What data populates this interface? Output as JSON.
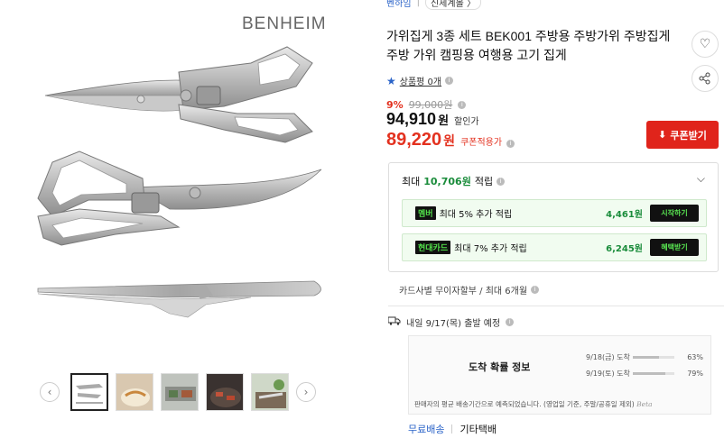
{
  "gallery": {
    "brand": "BENHEIM",
    "prev_icon": "chevron-left-icon",
    "next_icon": "chevron-right-icon",
    "thumbnail_count": 5,
    "active_thumbnail": 1
  },
  "breadcrumb": {
    "item1": "벤하임",
    "separator": "|",
    "item2": "신세계몰 〉"
  },
  "product": {
    "title": "가위집게 3종 세트 BEK001 주방용 주방가위 주방집게 주방 가위 캠핑용 여행용 고기 집게",
    "rating_label": "상품평 0개",
    "discount_rate": "9%",
    "original_price": "99,000원",
    "sale_price": "94,910",
    "sale_price_unit": "원",
    "sale_price_label": "할인가",
    "coupon_price": "89,220",
    "coupon_price_unit": "원",
    "coupon_price_label": "쿠폰적용가",
    "coupon_button": "쿠폰받기",
    "like_icon": "heart-icon",
    "share_icon": "share-icon"
  },
  "rewards": {
    "header_prefix": "최대",
    "header_amount": "10,706원",
    "header_suffix": "적립",
    "rows": [
      {
        "tag": "멤버",
        "text": "최대 5% 추가 적립",
        "amount": "4,461원",
        "button": "시작하기"
      },
      {
        "tag": "현대카드",
        "text": "최대 7% 추가 적립",
        "amount": "6,245원",
        "button": "혜택받기"
      }
    ]
  },
  "installment": "카드사별 무이자할부 / 최대 6개월",
  "shipping": {
    "headline": "내일 9/17(목) 출발 예정",
    "box_title": "도착 확률 정보",
    "rows": [
      {
        "date": "9/18(금) 도착",
        "percent_label": "63%",
        "fill": 0.63
      },
      {
        "date": "9/19(토) 도착",
        "percent_label": "79%",
        "fill": 0.79
      }
    ],
    "note": "판매자의 평균 배송기간으로 예측되었습니다. (영업일 기준, 주말/공휴일 제외)",
    "note_beta": "Beta"
  },
  "delivery": {
    "free": "무료배송",
    "carrier": "기타택배"
  },
  "colors": {
    "accent_red": "#e0241b",
    "reward_green": "#1a8c3b",
    "link_blue": "#2a63c8"
  }
}
